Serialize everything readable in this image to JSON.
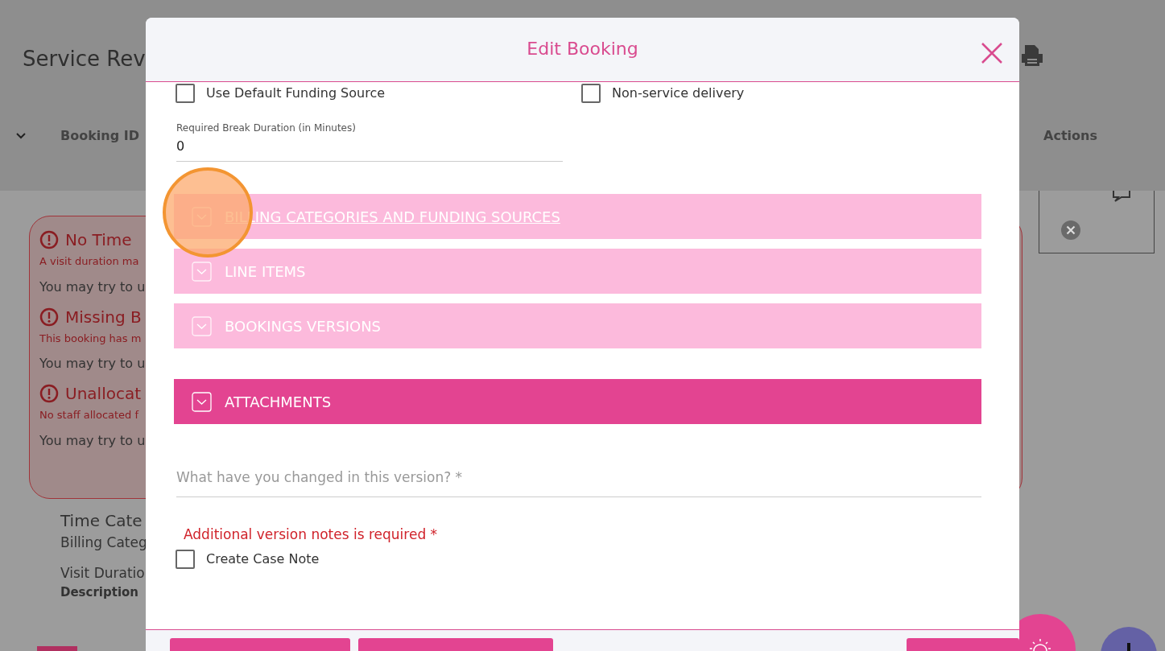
{
  "background": {
    "page_title": "Service Rev",
    "table_headers": [
      "Booking ID",
      "Actions"
    ],
    "alerts": [
      {
        "title": "No Time",
        "detail": "A visit duration ma",
        "hint": "You may try to u"
      },
      {
        "title": "Missing B",
        "detail": "This booking has m",
        "hint": "You may try to u"
      },
      {
        "title": "Unallocat",
        "detail": "No staff allocated f",
        "hint": "You may try to u"
      }
    ],
    "details": [
      {
        "kind": "heading",
        "text": "Time Cate"
      },
      {
        "kind": "text",
        "text": "Billing Categ"
      },
      {
        "kind": "text",
        "text": "Visit Duratio"
      },
      {
        "kind": "bold",
        "text": "Description"
      }
    ]
  },
  "modal": {
    "title": "Edit Booking",
    "checkboxes": [
      {
        "label": "Use Default Funding Source",
        "checked": false
      },
      {
        "label": "Non-service delivery",
        "checked": false
      }
    ],
    "break_field": {
      "label": "Required Break Duration (in Minutes)",
      "value": "0"
    },
    "sections": [
      {
        "title": "BILLING CATEGORIES AND FUNDING SOURCES",
        "disabled": true,
        "hovered": true
      },
      {
        "title": "LINE ITEMS",
        "disabled": true,
        "hovered": false
      },
      {
        "title": "BOOKINGS VERSIONS",
        "disabled": true,
        "hovered": false
      },
      {
        "title": "ATTACHMENTS",
        "disabled": false,
        "hovered": false
      }
    ],
    "notes_field": {
      "placeholder": "What have you changed in this version? *"
    },
    "error": "Additional version notes is required *",
    "case_note": {
      "label": "Create Case Note",
      "checked": false
    },
    "footer_buttons": [
      {
        "kind": "primary"
      },
      {
        "kind": "primary"
      },
      {
        "kind": "primary"
      }
    ]
  }
}
